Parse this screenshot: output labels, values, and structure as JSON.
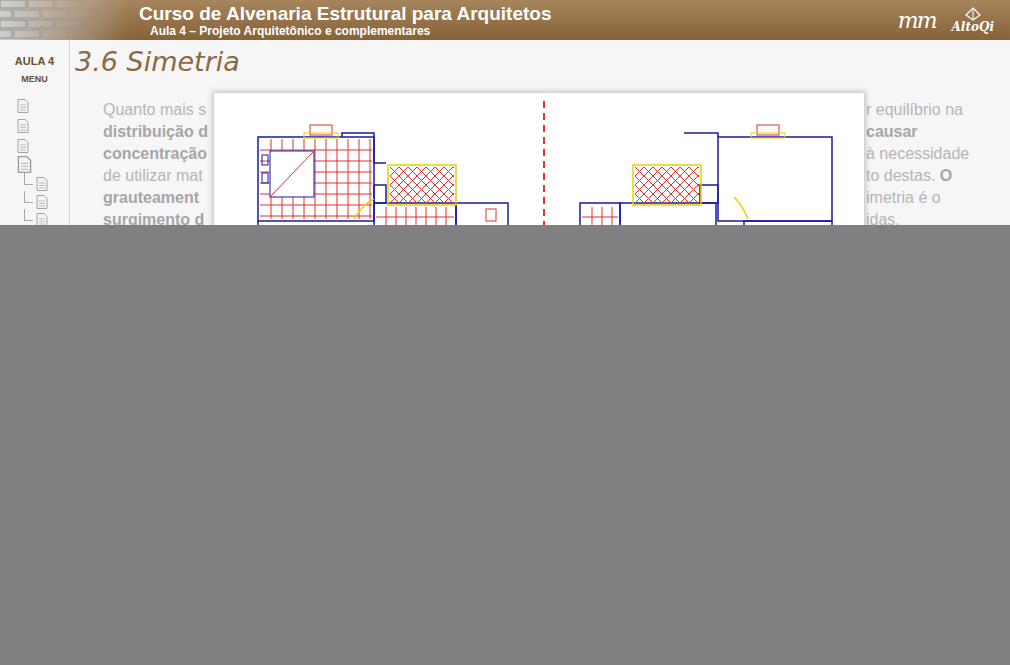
{
  "header": {
    "title": "Curso de Alvenaria Estrutural para Arquitetos",
    "subtitle": "Aula 4 – Projeto Arquitetônico e complementares",
    "logos": [
      "mm",
      "AltoQi"
    ]
  },
  "sidebar": {
    "lesson": "AULA 4",
    "menu": "MENU",
    "items": [
      {
        "kind": "page",
        "selected": false
      },
      {
        "kind": "page",
        "selected": false
      },
      {
        "kind": "page",
        "selected": false
      },
      {
        "kind": "page",
        "selected": true
      },
      {
        "kind": "subpage",
        "selected": false
      },
      {
        "kind": "subpage",
        "selected": false
      },
      {
        "kind": "subpage",
        "selected": false
      },
      {
        "kind": "subpage",
        "selected": false
      }
    ]
  },
  "section": {
    "title": "3.6 Simetria"
  },
  "paragraph": [
    {
      "left": [
        {
          "text": "Quanto mais s",
          "bold": false
        }
      ],
      "right": [
        {
          "text": "r equilíbrio na",
          "bold": false
        }
      ]
    },
    {
      "left": [
        {
          "text": "distribuição d",
          "bold": true
        }
      ],
      "right": [
        {
          "text": "causar",
          "bold": true
        }
      ]
    },
    {
      "left": [
        {
          "text": "concentração",
          "bold": true
        }
      ],
      "right": [
        {
          "text": "à necessidade",
          "bold": false
        }
      ]
    },
    {
      "left": [
        {
          "text": "de utilizar mat",
          "bold": false
        }
      ],
      "right": [
        {
          "text": "to destas. ",
          "bold": false
        },
        {
          "text": "O",
          "bold": true
        }
      ]
    },
    {
      "left": [
        {
          "text": "grauteament",
          "bold": true
        }
      ],
      "right": [
        {
          "text": "imetria é o",
          "bold": false
        }
      ]
    },
    {
      "left": [
        {
          "text": "surgimento d",
          "bold": true
        }
      ],
      "right": [
        {
          "text": "idas.",
          "bold": false
        }
      ]
    }
  ],
  "figure": {
    "shown": true
  },
  "overlay": {
    "shown": true
  }
}
